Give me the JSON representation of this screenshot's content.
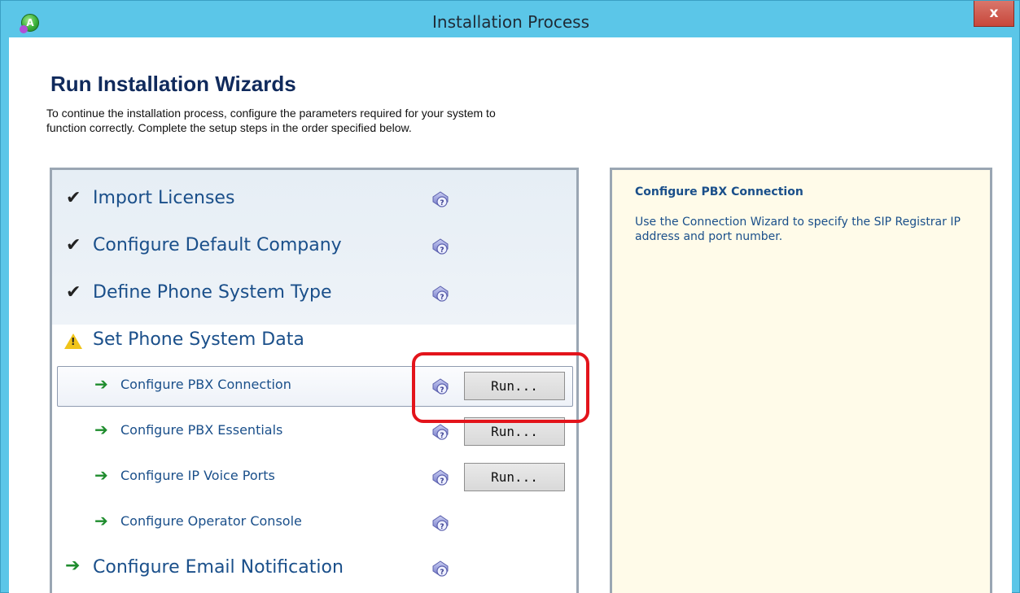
{
  "window": {
    "title": "Installation Process",
    "app_icon_letter": "A",
    "close_label": "x"
  },
  "header": {
    "title": "Run Installation Wizards",
    "description_line1": "To continue the installation process, configure the parameters required for your system to",
    "description_line2": "function correctly.  Complete the setup steps in the order specified below."
  },
  "steps": [
    {
      "label": "Import Licenses",
      "status": "done",
      "icon": "checkmark-icon"
    },
    {
      "label": "Configure Default Company",
      "status": "done",
      "icon": "checkmark-icon"
    },
    {
      "label": "Define Phone System Type",
      "status": "done",
      "icon": "checkmark-icon"
    },
    {
      "label": "Set Phone System Data",
      "status": "warning",
      "icon": "warning-icon"
    },
    {
      "label": "Configure PBX Connection",
      "status": "pending",
      "icon": "arrow-right-icon",
      "run_label": "Run...",
      "selected": true
    },
    {
      "label": "Configure PBX Essentials",
      "status": "pending",
      "icon": "arrow-right-icon",
      "run_label": "Run..."
    },
    {
      "label": "Configure IP Voice Ports",
      "status": "pending",
      "icon": "arrow-right-icon",
      "run_label": "Run..."
    },
    {
      "label": "Configure Operator Console",
      "status": "pending",
      "icon": "arrow-right-icon"
    },
    {
      "label": "Configure Email Notification",
      "status": "pending",
      "icon": "arrow-right-icon"
    }
  ],
  "info": {
    "title": "Configure PBX Connection",
    "text": "Use the Connection Wizard to specify the SIP Registrar IP address and port number."
  },
  "colors": {
    "titlebar": "#5bc6e8",
    "heading": "#102a5c",
    "step_text": "#1a4f8a",
    "arrow": "#1e8c2d",
    "highlight": "#e3141b",
    "info_bg": "#fffbe9"
  },
  "icons": {
    "check": "✔",
    "arrow": "➔",
    "warning_mark": "!"
  }
}
